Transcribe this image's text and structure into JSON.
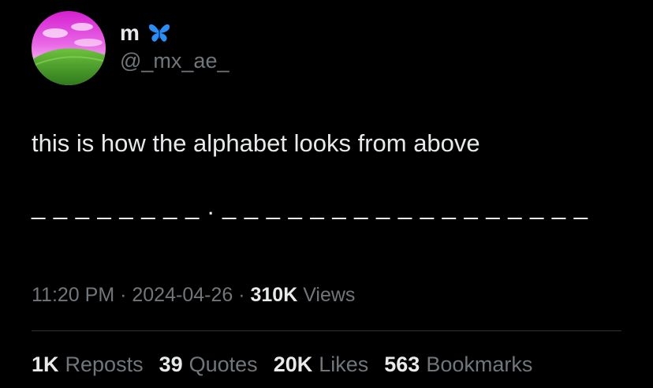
{
  "author": {
    "display_name": "m",
    "badge_icon": "butterfly-icon",
    "handle": "@_mx_ae_",
    "avatar": "pink-sky-green-hill-avatar"
  },
  "tweet": {
    "text_line1": "this is how the alphabet looks from above",
    "text_line2": "_ _ _ _ _ _ _ _ . _ _ _ _ _ _ _ _ _ _ _ _ _ _ _ _ _"
  },
  "meta": {
    "time": "11:20 PM",
    "sep1": " · ",
    "date": "2024-04-26",
    "sep2": " · ",
    "views_count": "310K",
    "views_label": " Views"
  },
  "stats": {
    "reposts_count": "1K",
    "reposts_label": "Reposts",
    "quotes_count": "39",
    "quotes_label": "Quotes",
    "likes_count": "20K",
    "likes_label": "Likes",
    "bookmarks_count": "563",
    "bookmarks_label": "Bookmarks"
  },
  "colors": {
    "background": "#000000",
    "primary_text": "#e7e9ea",
    "secondary_text": "#71767b",
    "divider": "#2f3336",
    "badge_blue": "#2c8ef5"
  }
}
